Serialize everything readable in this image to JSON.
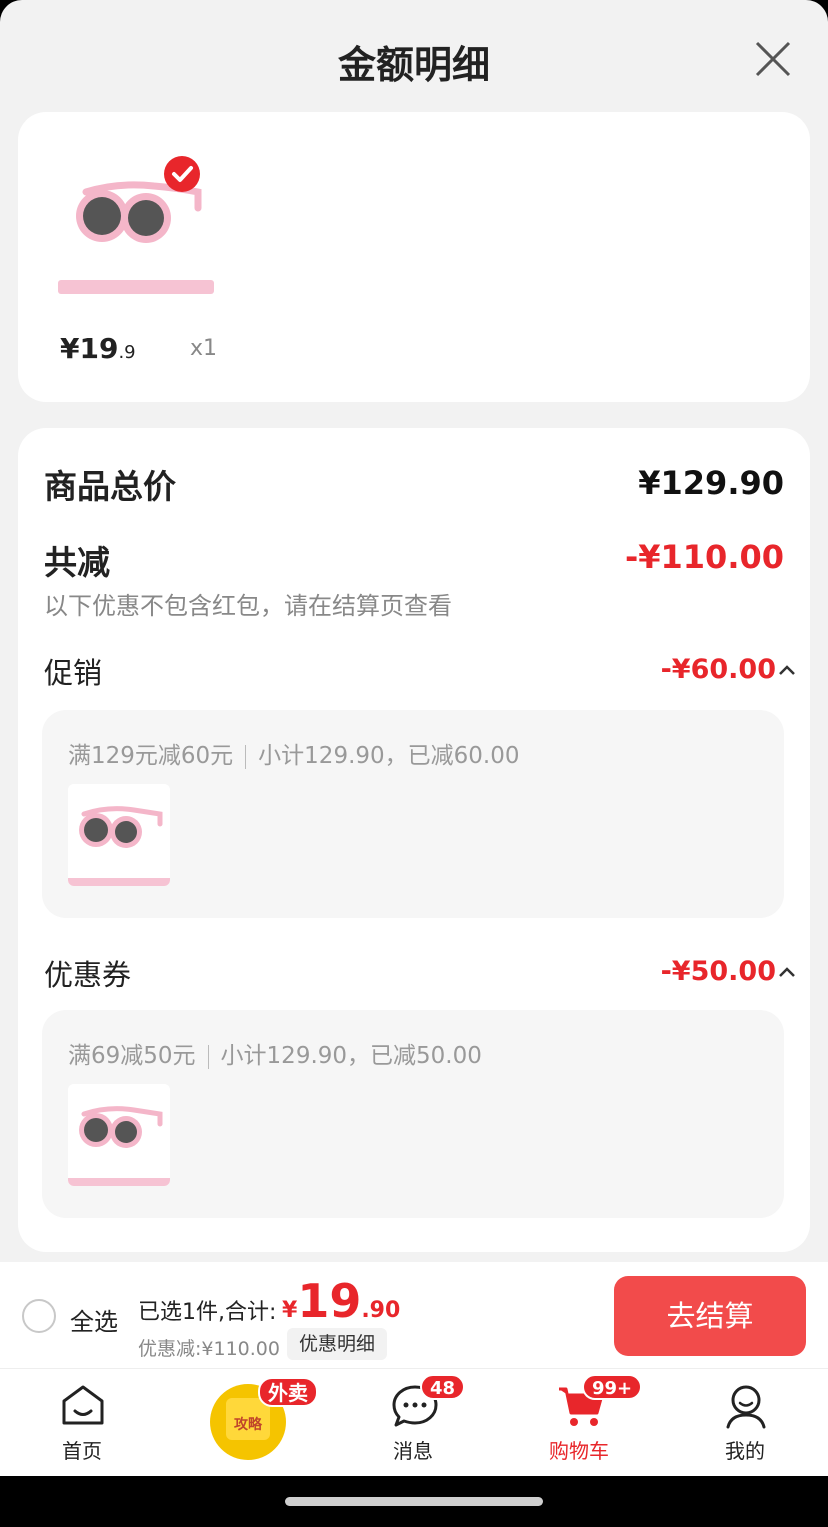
{
  "sheet": {
    "title": "金额明细"
  },
  "product": {
    "price_int": "¥19",
    "price_dec": ".9",
    "qty": "x1"
  },
  "summary": {
    "total_label": "商品总价",
    "total_value": "¥129.90",
    "reduce_label": "共减",
    "reduce_value": "-¥110.00",
    "note": "以下优惠不包含红包，请在结算页查看"
  },
  "promotion": {
    "label": "促销",
    "value": "-¥60.00",
    "rule": "满129元减60元",
    "detail": "小计129.90，已减60.00"
  },
  "coupon": {
    "label": "优惠券",
    "value": "-¥50.00",
    "rule": "满69减50元",
    "detail": "小计129.90，已减50.00"
  },
  "checkout": {
    "select_all": "全选",
    "selected_text": "已选1件,合计:",
    "total_yen": "¥",
    "total_int": "19",
    "total_dec": ".90",
    "discount_text": "优惠减:¥110.00",
    "detail_tag": "优惠明细",
    "pay_button": "去结算"
  },
  "tabbar": {
    "home": "首页",
    "promo_inner": "攻略",
    "promo_badge": "外卖",
    "messages": "消息",
    "messages_badge": "48",
    "cart": "购物车",
    "cart_badge": "99+",
    "mine": "我的"
  },
  "colors": {
    "accent": "#e8262b",
    "pay_button": "#f24b4b",
    "sheet_bg": "#f2f2f2"
  }
}
